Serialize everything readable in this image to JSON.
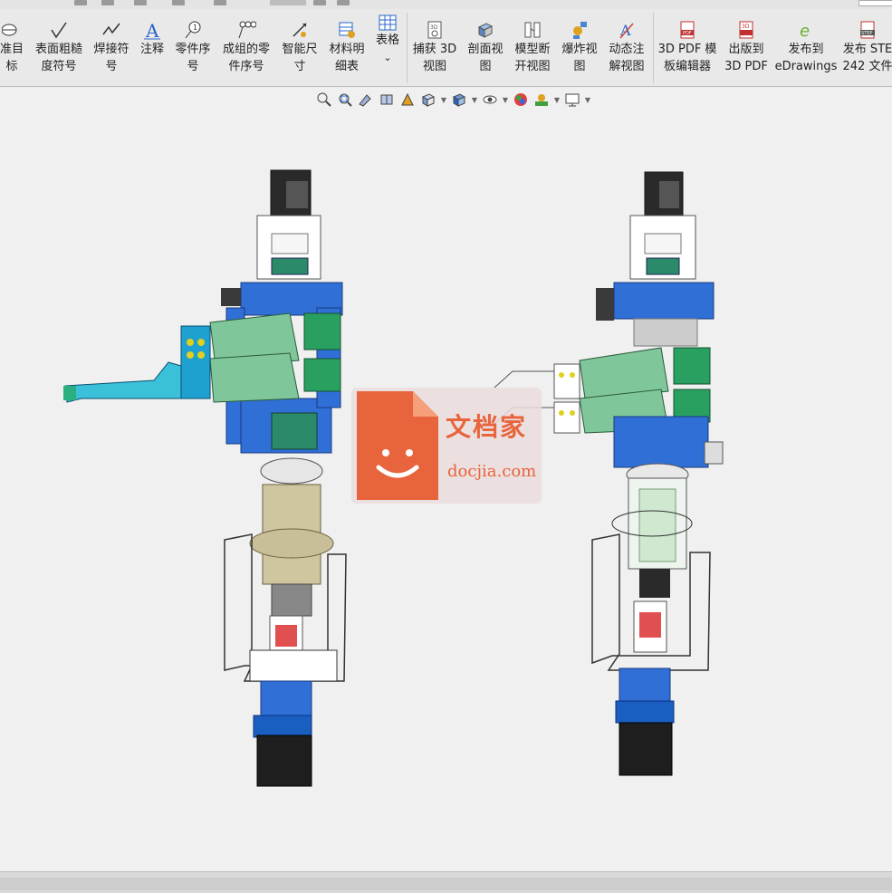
{
  "ribbon": {
    "buttons": [
      {
        "label1": "准目",
        "label2": "标",
        "icon": "datum-target-icon"
      },
      {
        "label1": "表面粗糙",
        "label2": "度符号",
        "icon": "surface-finish-icon"
      },
      {
        "label1": "焊接符",
        "label2": "号",
        "icon": "weld-symbol-icon"
      },
      {
        "label1": "注释",
        "label2": "",
        "icon": "note-icon"
      },
      {
        "label1": "零件序",
        "label2": "号",
        "icon": "balloon-icon"
      },
      {
        "label1": "成组的零",
        "label2": "件序号",
        "icon": "stacked-balloon-icon"
      },
      {
        "label1": "智能尺",
        "label2": "寸",
        "icon": "smart-dimension-icon"
      },
      {
        "label1": "材料明",
        "label2": "细表",
        "icon": "bill-of-materials-icon"
      },
      {
        "label1": "表格",
        "label2": "",
        "icon": "table-icon"
      },
      {
        "label1": "捕获 3D",
        "label2": "视图",
        "icon": "capture-3d-view-icon"
      },
      {
        "label1": "剖面视",
        "label2": "图",
        "icon": "section-view-icon"
      },
      {
        "label1": "模型断",
        "label2": "开视图",
        "icon": "model-break-view-icon"
      },
      {
        "label1": "爆炸视",
        "label2": "图",
        "icon": "exploded-view-icon"
      },
      {
        "label1": "动态注",
        "label2": "解视图",
        "icon": "dynamic-annotation-icon"
      },
      {
        "label1": "3D PDF 模",
        "label2": "板编辑器",
        "icon": "3d-pdf-template-icon"
      },
      {
        "label1": "出版到",
        "label2": "3D PDF",
        "icon": "publish-3d-pdf-icon"
      },
      {
        "label1": "发布到",
        "label2": "eDrawings",
        "icon": "edrawings-icon"
      },
      {
        "label1": "发布 STE",
        "label2": "242 文件",
        "icon": "step-export-icon"
      }
    ],
    "table_dropdown": "⌄"
  },
  "view_toolbar": {
    "icons": [
      "zoom-to-fit-icon",
      "zoom-to-area-icon",
      "previous-view-icon",
      "section-view-icon",
      "dynamic-annotation-view-icon",
      "view-orientation-icon",
      "display-style-icon",
      "hide-show-items-icon",
      "edit-appearance-icon",
      "apply-scene-icon",
      "view-settings-icon"
    ]
  },
  "watermark": {
    "cn": "文档家",
    "en": "docjia.com",
    "colors": {
      "accent": "#e8643c"
    }
  },
  "colors": {
    "ribbon_bg": "#e9e9e9",
    "viewport_bg": "#f0f0f0",
    "part_blue": "#2f6fd6",
    "part_green": "#7fc79a",
    "motor_black": "#1e1e1e"
  }
}
